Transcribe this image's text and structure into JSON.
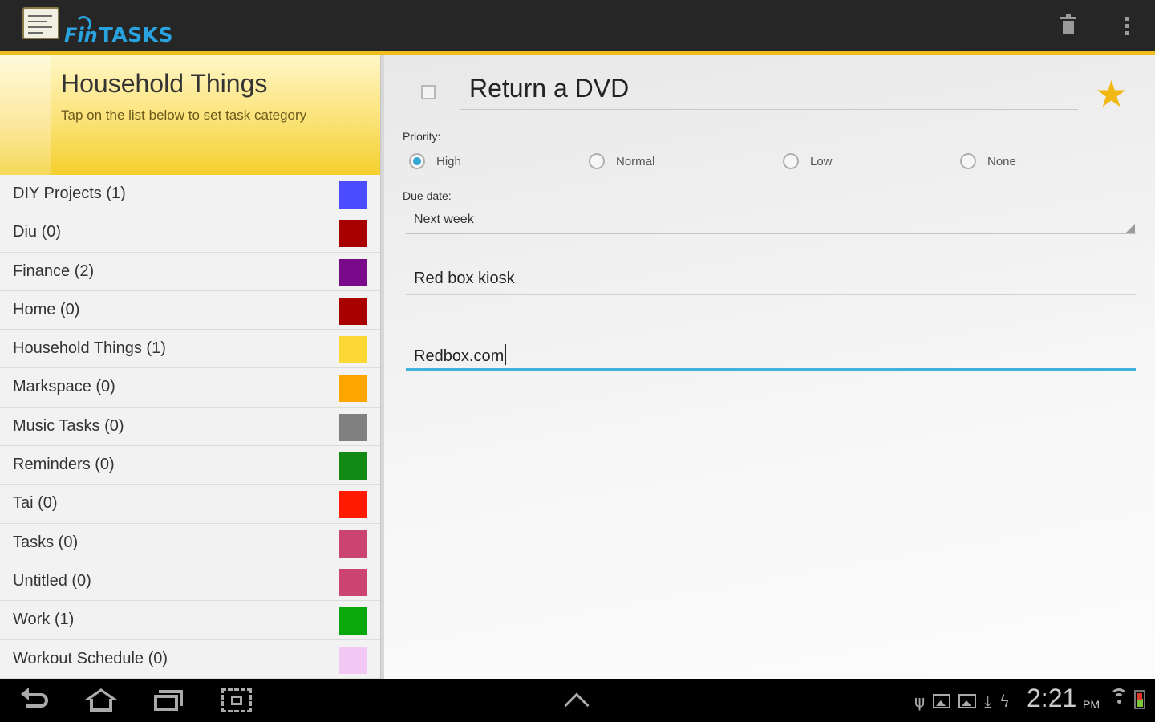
{
  "app": {
    "logo_prefix": "Fin",
    "logo_text": "TASKS"
  },
  "actionbar": {
    "trash_icon": "trash-icon",
    "overflow_icon": "overflow-menu-icon",
    "accent_color": "#f0bd1e"
  },
  "category_panel": {
    "title": "Household Things",
    "subtitle": "Tap on the list below to set task category",
    "categories": [
      {
        "label": "DIY Projects (1)",
        "color": "#4b4bff"
      },
      {
        "label": "Diu (0)",
        "color": "#a80000"
      },
      {
        "label": "Finance (2)",
        "color": "#7a0a8c"
      },
      {
        "label": "Home (0)",
        "color": "#a80000"
      },
      {
        "label": "Household Things (1)",
        "color": "#fdd835"
      },
      {
        "label": "Markspace (0)",
        "color": "#ffa500"
      },
      {
        "label": "Music Tasks (0)",
        "color": "#808080"
      },
      {
        "label": "Reminders (0)",
        "color": "#138a13"
      },
      {
        "label": "Tai (0)",
        "color": "#ff1a00"
      },
      {
        "label": "Tasks (0)",
        "color": "#cc4472"
      },
      {
        "label": "Untitled (0)",
        "color": "#cc4472"
      },
      {
        "label": "Work (1)",
        "color": "#0aa80a"
      },
      {
        "label": "Workout Schedule (0)",
        "color": "#f4c8f4"
      }
    ]
  },
  "task": {
    "title": "Return a DVD",
    "starred": true,
    "priority_label": "Priority:",
    "priority_options": [
      {
        "label": "High",
        "selected": true
      },
      {
        "label": "Normal",
        "selected": false
      },
      {
        "label": "Low",
        "selected": false
      },
      {
        "label": "None",
        "selected": false
      }
    ],
    "due_label": "Due date:",
    "due_value": "Next week",
    "note_field": "Red box kiosk",
    "url_field": "Redbox.com"
  },
  "system_bar": {
    "time": "2:21",
    "ampm": "PM",
    "accent_color": "#43b1dd"
  }
}
